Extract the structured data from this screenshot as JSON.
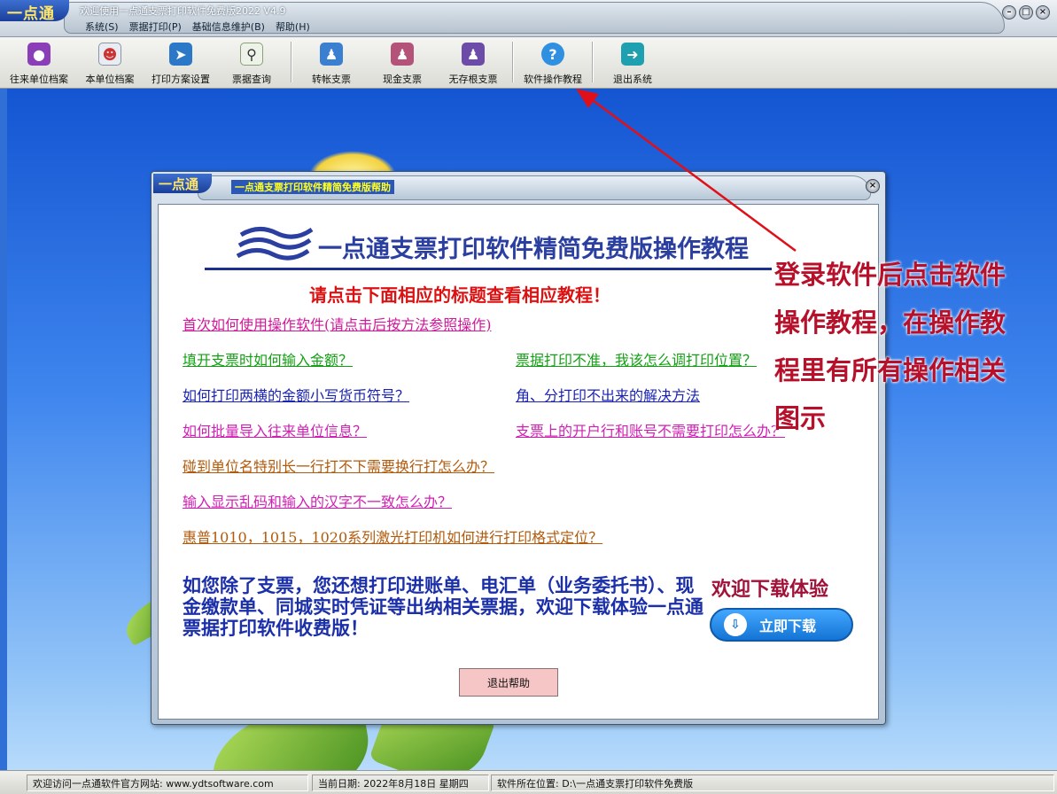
{
  "window": {
    "brand": "一点通",
    "title": "欢迎使用一点通支票打印软件免费版2022 V4.9"
  },
  "menu": [
    "系统(S)",
    "票据打印(P)",
    "基础信息维护(B)",
    "帮助(H)"
  ],
  "toolbar": [
    {
      "label": "往来单位档案",
      "icon": "contacts-archive-icon"
    },
    {
      "label": "本单位档案",
      "icon": "company-card-icon"
    },
    {
      "label": "打印方案设置",
      "icon": "print-settings-icon"
    },
    {
      "label": "票据查询",
      "icon": "search-document-icon"
    },
    {
      "label": "转帐支票",
      "icon": "user-transfer-icon"
    },
    {
      "label": "现金支票",
      "icon": "user-cash-icon"
    },
    {
      "label": "无存根支票",
      "icon": "user-nostub-icon"
    },
    {
      "label": "软件操作教程",
      "icon": "help-icon"
    },
    {
      "label": "退出系统",
      "icon": "exit-icon"
    }
  ],
  "dialog": {
    "title": "一点通支票打印软件精简免费版帮助",
    "heading": "一点通支票打印软件精简免费版操作教程",
    "subtitle": "请点击下面相应的标题查看相应教程！",
    "links": [
      {
        "text": "首次如何使用操作软件(请点击后按方法参照操作)",
        "color": "#d1179a"
      },
      {
        "text": "填开支票时如何输入金额？",
        "color": "#13a013"
      },
      {
        "text": "票据打印不准，我该怎么调打印位置？",
        "color": "#13a013"
      },
      {
        "text": "如何打印两横的金额小写货币符号？",
        "color": "#1b23b5"
      },
      {
        "text": "角、分打印不出来的解决方法",
        "color": "#1b23b5"
      },
      {
        "text": "如何批量导入往来单位信息？",
        "color": "#d11fb4"
      },
      {
        "text": "支票上的开户行和账号不需要打印怎么办？",
        "color": "#d11fb4"
      },
      {
        "text": "碰到单位名特别长一行打不下需要换行打怎么办？",
        "color": "#b25a0c"
      },
      {
        "text": "输入显示乱码和输入的汉字不一致怎么办？",
        "color": "#d11fb4"
      },
      {
        "text": "惠普1010，1015，1020系列激光打印机如何进行打印格式定位？",
        "color": "#b25a0c"
      }
    ],
    "promo": "如您除了支票，您还想打印进账单、电汇单（业务委托书）、现金缴款单、同城实时凭证等出纳相关票据，欢迎下载体验一点通票据打印软件收费版！",
    "welcome": "欢迎下载体验",
    "download_label": "立即下载",
    "exit_label": "退出帮助"
  },
  "annotation": "登录软件后点击软件操作教程，在操作教程里有所有操作相关图示",
  "status": {
    "website": "欢迎访问一点通软件官方网站: www.ydtsoftware.com",
    "date": "当前日期: 2022年8月18日 星期四",
    "location": "软件所在位置: D:\\一点通支票打印软件免费版"
  }
}
